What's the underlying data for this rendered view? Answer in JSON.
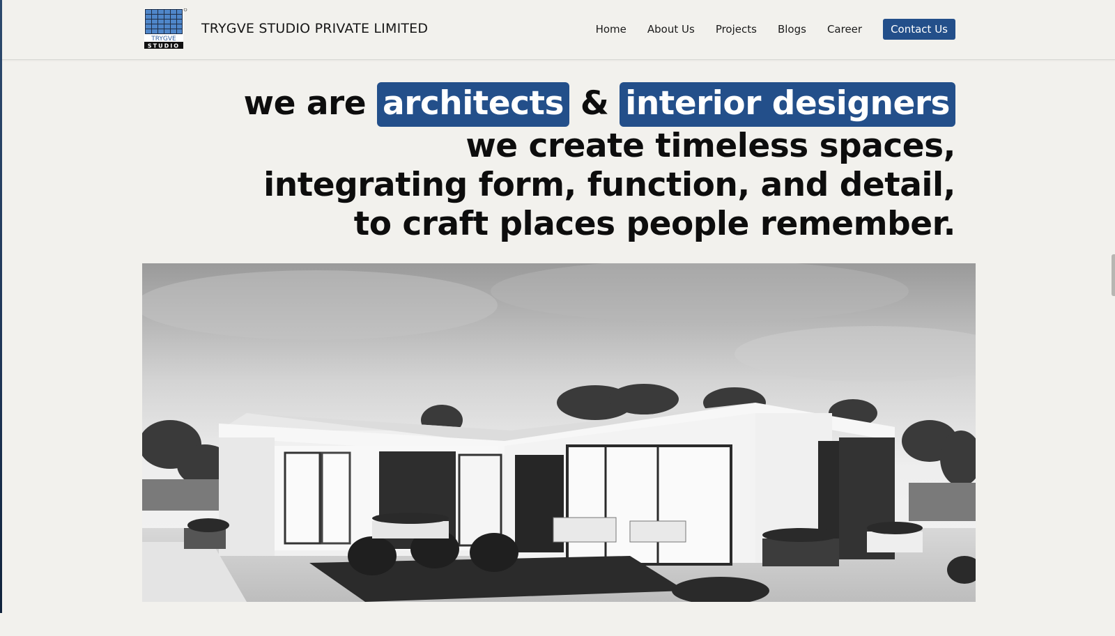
{
  "header": {
    "logo_text_top": "TRYGVE",
    "logo_text_bottom": "STUDIO",
    "brand_name": "TRYGVE STUDIO PRIVATE LIMITED",
    "nav": [
      {
        "label": "Home"
      },
      {
        "label": "About Us"
      },
      {
        "label": "Projects"
      },
      {
        "label": "Blogs"
      },
      {
        "label": "Career"
      }
    ],
    "contact_label": "Contact Us"
  },
  "hero": {
    "prefix": "we are",
    "highlight_1": "architects",
    "connector": "&",
    "highlight_2": "interior designers",
    "line_2": "we create timeless spaces,",
    "line_3": "integrating form, function, and detail,",
    "line_4": "to craft places people remember."
  },
  "colors": {
    "accent": "#234f8a",
    "background": "#f2f1ed"
  },
  "image": {
    "semantic": "grayscale-modern-house-photo"
  }
}
